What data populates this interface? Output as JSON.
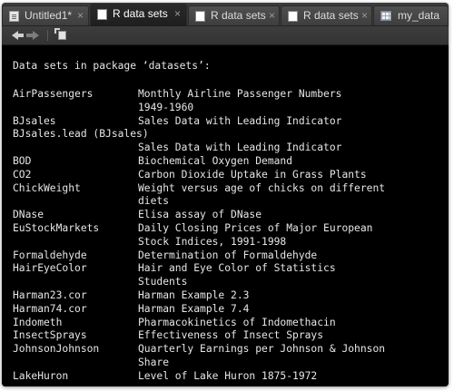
{
  "tabs": [
    {
      "label": "Untitled1*",
      "icon": "r-script-file-icon",
      "close": "×",
      "active": false
    },
    {
      "label": "R data sets",
      "icon": "document-icon",
      "close": "×",
      "active": true
    },
    {
      "label": "R data sets",
      "icon": "document-icon",
      "close": "×",
      "active": false
    },
    {
      "label": "R data sets",
      "icon": "document-icon",
      "close": "×",
      "active": false
    },
    {
      "label": "my_data",
      "icon": "table-grid-icon",
      "close": "×",
      "active": false
    }
  ],
  "toolbar": {
    "back_icon": "back-arrow-icon",
    "forward_icon": "forward-arrow-icon",
    "popout_icon": "show-in-new-window-icon"
  },
  "content": {
    "heading": "Data sets in package ‘datasets’:",
    "datasets": [
      {
        "name": "AirPassengers",
        "description": "Monthly Airline Passenger Numbers\n1949-1960"
      },
      {
        "name": "BJsales",
        "description": "Sales Data with Leading Indicator"
      },
      {
        "name": "BJsales.lead (BJsales)",
        "description": ""
      },
      {
        "name": "",
        "description": "Sales Data with Leading Indicator"
      },
      {
        "name": "BOD",
        "description": "Biochemical Oxygen Demand"
      },
      {
        "name": "CO2",
        "description": "Carbon Dioxide Uptake in Grass Plants"
      },
      {
        "name": "ChickWeight",
        "description": "Weight versus age of chicks on different\ndiets"
      },
      {
        "name": "DNase",
        "description": "Elisa assay of DNase"
      },
      {
        "name": "EuStockMarkets",
        "description": "Daily Closing Prices of Major European\nStock Indices, 1991-1998"
      },
      {
        "name": "Formaldehyde",
        "description": "Determination of Formaldehyde"
      },
      {
        "name": "HairEyeColor",
        "description": "Hair and Eye Color of Statistics\nStudents"
      },
      {
        "name": "Harman23.cor",
        "description": "Harman Example 2.3"
      },
      {
        "name": "Harman74.cor",
        "description": "Harman Example 7.4"
      },
      {
        "name": "Indometh",
        "description": "Pharmacokinetics of Indomethacin"
      },
      {
        "name": "InsectSprays",
        "description": "Effectiveness of Insect Sprays"
      },
      {
        "name": "JohnsonJohnson",
        "description": "Quarterly Earnings per Johnson & Johnson\nShare"
      },
      {
        "name": "LakeHuron",
        "description": "Level of Lake Huron 1875-1972"
      }
    ]
  },
  "colors": {
    "background": "#000000",
    "text": "#e6e6e6",
    "tabbar": "#3b3b3b"
  }
}
